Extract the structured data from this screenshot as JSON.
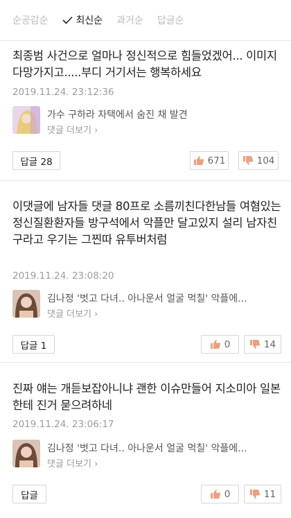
{
  "sort_tabs": [
    {
      "label": "순공감순",
      "active": false
    },
    {
      "label": "최신순",
      "active": true
    },
    {
      "label": "과거순",
      "active": false
    },
    {
      "label": "답글순",
      "active": false
    }
  ],
  "comments": [
    {
      "text": "최종범 사건으로 얼마나 정신적으로 힘들었겠어... 이미지 다망가지고.....부디 거기서는 행복하세요",
      "date": "2019.11.24. 23:12:36",
      "article_title": "가수 구하라 자택에서 숨진 채 발견",
      "more": "댓글 더보기 ›",
      "reply": "답글 28",
      "likes": "671",
      "dislikes": "104"
    },
    {
      "text": "이댓글에 남자들 댓글 80프로 소름끼친다한남들 여혐있는 정신질환환자들 방구석에서 악플만 달고있지 설리 남자친구라고 우기는 그찐따 유투버처럼",
      "date": "2019.11.24. 23:08:20",
      "article_title": "김나정 '벗고 다녀.. 아나운서 얼굴 먹칠' 악플에...",
      "more": "댓글 더보기 ›",
      "reply": "답글 1",
      "likes": "0",
      "dislikes": "14"
    },
    {
      "text": "진짜 얘는 개듣보잡아니냐 괜한 이슈만들어 지소미아 일본한테 진거 묻으려하네",
      "date": "2019.11.24. 23:06:17",
      "article_title": "김나정 '벗고 다녀.. 아나운서 얼굴 먹칠' 악플에...",
      "more": "댓글 더보기 ›",
      "reply": "답글",
      "likes": "0",
      "dislikes": "11"
    }
  ]
}
